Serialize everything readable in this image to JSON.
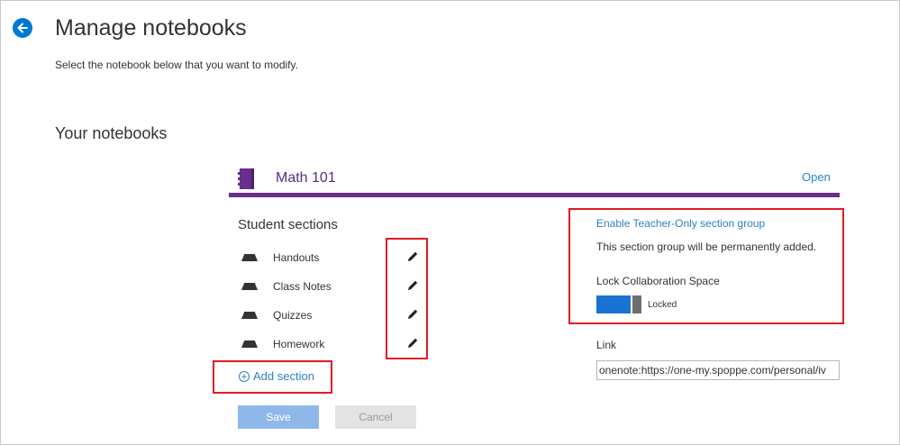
{
  "header": {
    "title": "Manage notebooks",
    "subtitle": "Select the notebook below that you want to modify.",
    "back_icon": "back-arrow-icon"
  },
  "notebooks": {
    "heading": "Your notebooks",
    "notebook": {
      "name": "Math 101",
      "open_label": "Open",
      "icon": "notebook-icon",
      "accent_color": "#6a2e8d"
    }
  },
  "student_sections": {
    "heading": "Student sections",
    "items": [
      {
        "label": "Handouts"
      },
      {
        "label": "Class Notes"
      },
      {
        "label": "Quizzes"
      },
      {
        "label": "Homework"
      }
    ],
    "add_label": "Add section"
  },
  "settings": {
    "teacher_only_link": "Enable Teacher-Only section group",
    "teacher_only_note": "This section group will be permanently added.",
    "lock_label": "Lock Collaboration Space",
    "lock_state": "Locked",
    "lock_on": true,
    "link_label": "Link",
    "link_value": "onenote:https://one-my.spoppe.com/personal/iv"
  },
  "actions": {
    "save_label": "Save",
    "cancel_label": "Cancel"
  },
  "colors": {
    "link": "#2f7fc1",
    "primary": "#0078d4",
    "highlight_box": "#e01b24"
  }
}
